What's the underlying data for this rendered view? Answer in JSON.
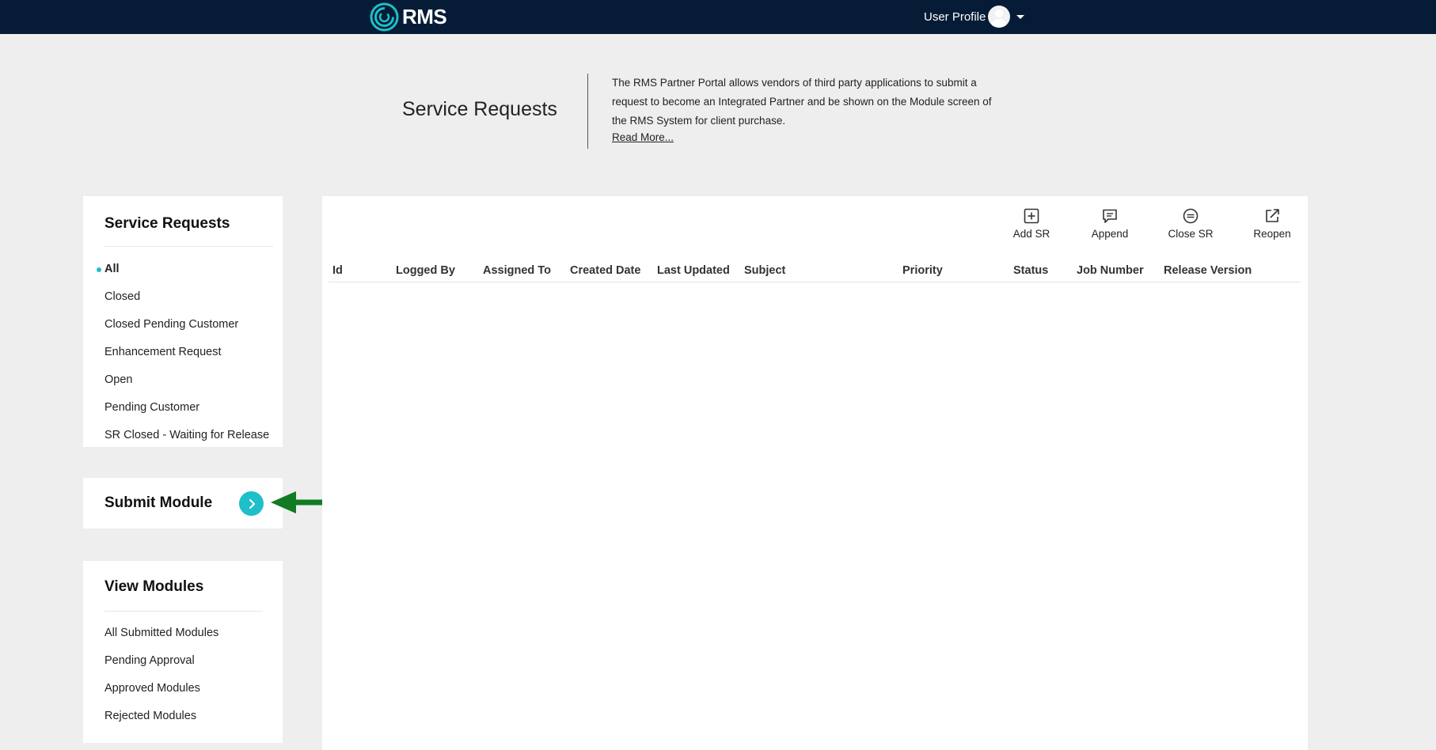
{
  "header": {
    "logo_text": "RMS",
    "user_profile_label": "User Profile",
    "brand_color": "#1ebfc8",
    "bar_color": "#061c36"
  },
  "hero": {
    "title": "Service Requests",
    "description": "The RMS Partner Portal allows vendors of third party applications to submit a request to become an Integrated Partner and be shown on the Module screen of the RMS System for client purchase.",
    "read_more": "Read More..."
  },
  "service_requests_panel": {
    "title": "Service Requests",
    "items": [
      {
        "label": "All",
        "active": true
      },
      {
        "label": "Closed"
      },
      {
        "label": "Closed Pending Customer"
      },
      {
        "label": "Enhancement Request"
      },
      {
        "label": "Open"
      },
      {
        "label": "Pending Customer"
      },
      {
        "label": "SR Closed - Waiting for Release"
      }
    ]
  },
  "submit_module_panel": {
    "title": "Submit Module",
    "button_icon": "chevron-right-icon"
  },
  "view_modules_panel": {
    "title": "View Modules",
    "items": [
      {
        "label": "All Submitted Modules"
      },
      {
        "label": "Pending Approval"
      },
      {
        "label": "Approved Modules"
      },
      {
        "label": "Rejected Modules"
      }
    ]
  },
  "toolbar": {
    "buttons": [
      {
        "label": "Add SR",
        "icon": "plus-square-icon"
      },
      {
        "label": "Append",
        "icon": "comment-icon"
      },
      {
        "label": "Close SR",
        "icon": "minus-circle-icon"
      },
      {
        "label": "Reopen",
        "icon": "external-link-icon"
      }
    ]
  },
  "table": {
    "columns": [
      "Id",
      "Logged By",
      "Assigned To",
      "Created Date",
      "Last Updated",
      "Subject",
      "Priority",
      "Status",
      "Job Number",
      "Release Version"
    ],
    "rows": []
  },
  "annotation": {
    "arrow_color": "#127a23"
  }
}
